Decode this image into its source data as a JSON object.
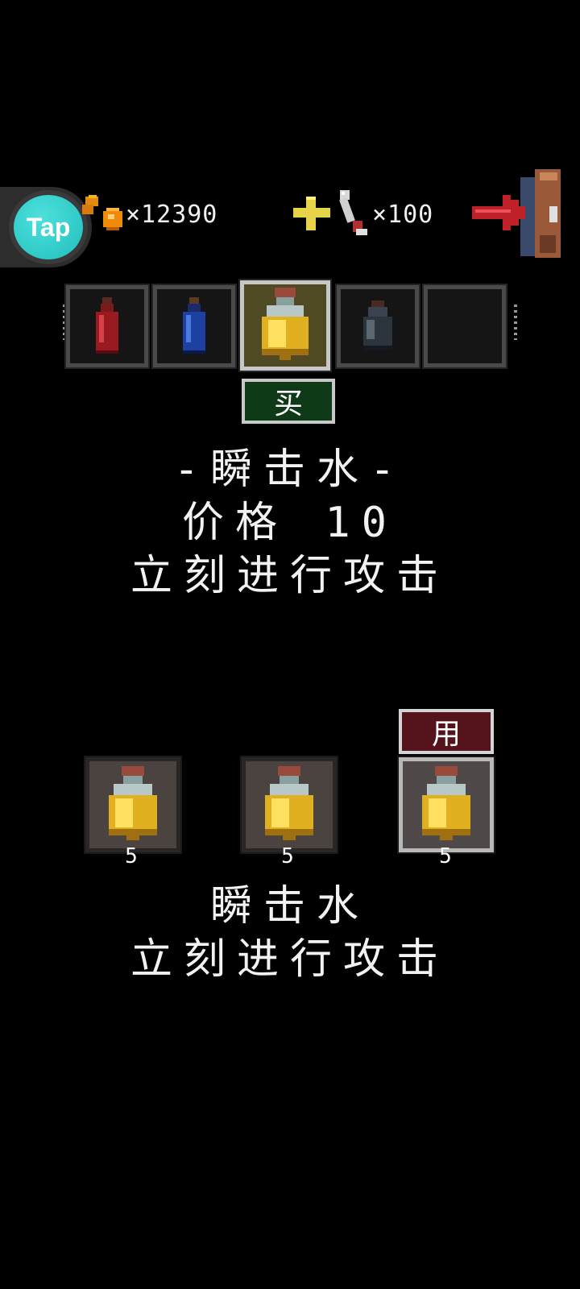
{
  "hud": {
    "tap_label": "Tap",
    "gold_count": "×12390",
    "gem_count": "×100",
    "icons": [
      "gold-coins-icon",
      "plus-icon",
      "bone-key-icon",
      "exit-door-icon"
    ]
  },
  "shop": {
    "slots": [
      {
        "item": "red-potion-icon",
        "selected": false
      },
      {
        "item": "blue-potion-icon",
        "selected": false
      },
      {
        "item": "yellow-potion-icon",
        "selected": true
      },
      {
        "item": "dark-potion-icon",
        "selected": false
      },
      {
        "item": "empty",
        "selected": false
      }
    ],
    "buy_label": "买",
    "item_title": "-瞬击水-",
    "price_line": "价格 10",
    "description": "立刻进行攻击"
  },
  "inventory": {
    "use_label": "用",
    "items": [
      {
        "item": "yellow-potion-icon",
        "count": "5",
        "selected": false
      },
      {
        "item": "yellow-potion-icon",
        "count": "5",
        "selected": false
      },
      {
        "item": "yellow-potion-icon",
        "count": "5",
        "selected": true
      }
    ],
    "item_name": "瞬击水",
    "description": "立刻进行攻击"
  },
  "colors": {
    "background": "#000000",
    "buy_button": "#0f3a18",
    "use_button": "#55131b",
    "tap_logo": "#1fbfbd"
  }
}
